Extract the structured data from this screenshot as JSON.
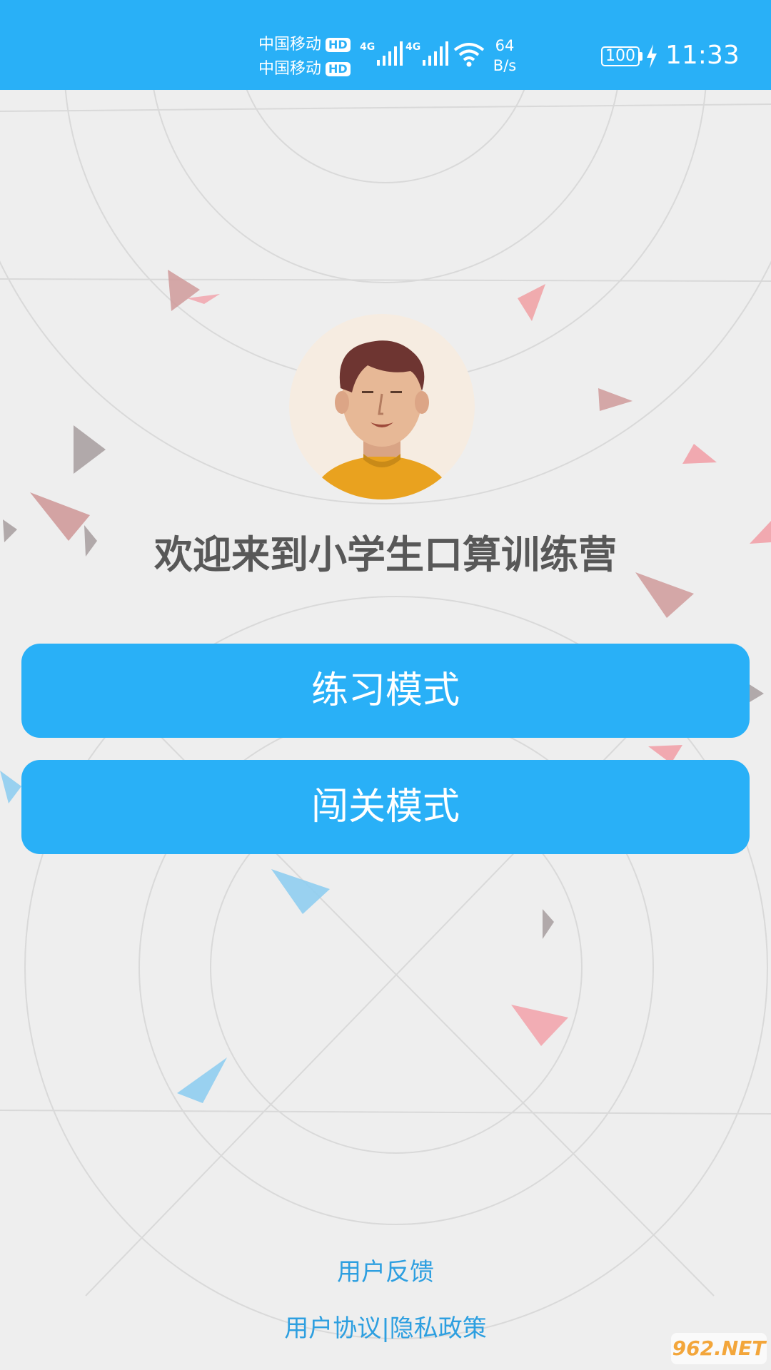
{
  "status_bar": {
    "carrier_1": "中国移动",
    "carrier_2": "中国移动",
    "hd_badge": "HD",
    "network_type_1": "4G",
    "network_type_2": "4G",
    "net_speed_value": "64",
    "net_speed_unit": "B/s",
    "battery_level": "100",
    "time": "11:33",
    "icons": [
      "hd-icon",
      "signal-icon",
      "wifi-icon",
      "battery-icon",
      "charging-bolt-icon"
    ]
  },
  "main": {
    "welcome_title": "欢迎来到小学生口算训练营",
    "avatar_icon": "user-avatar-icon",
    "practice_mode_label": "练习模式",
    "challenge_mode_label": "闯关模式"
  },
  "footer": {
    "feedback_link": "用户反馈",
    "agreement_link": "用户协议",
    "separator": "|",
    "privacy_link": "隐私政策"
  },
  "watermark": {
    "text": "962.NET"
  },
  "colors": {
    "primary": "#29b0f7",
    "background": "#eeeeee",
    "title_text": "#585858",
    "link_text": "#2d9fe0"
  }
}
